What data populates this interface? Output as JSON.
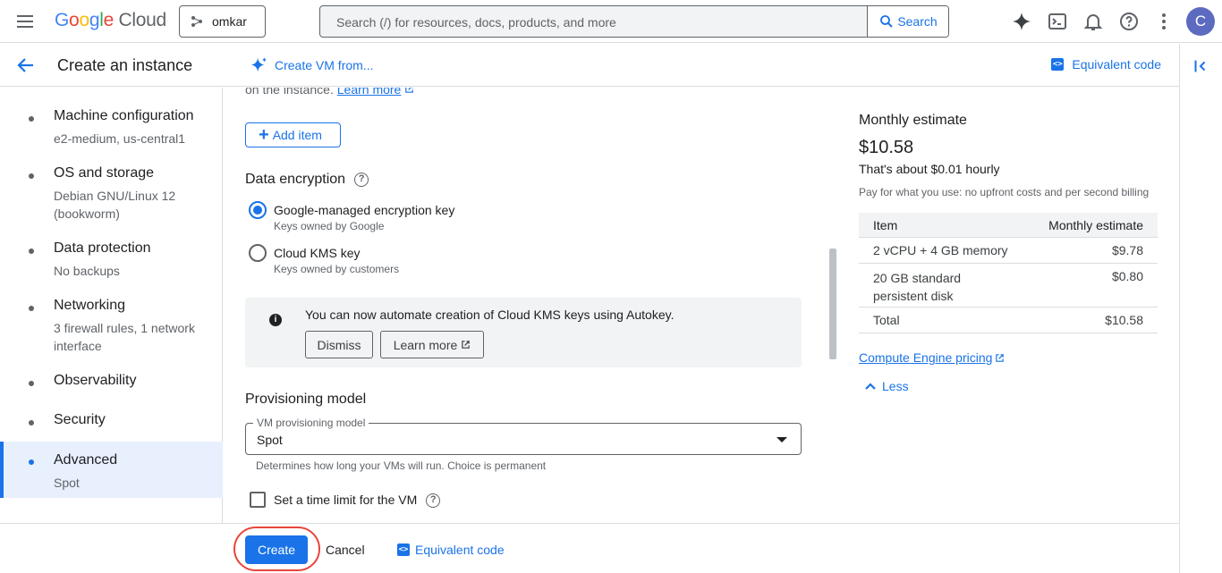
{
  "topbar": {
    "logo_google": "Google",
    "logo_cloud": "Cloud",
    "project": "omkar",
    "search_placeholder": "Search (/) for resources, docs, products, and more",
    "search_button": "Search",
    "avatar_letter": "C"
  },
  "header": {
    "title": "Create an instance",
    "create_from": "Create VM from...",
    "equivalent_code": "Equivalent code"
  },
  "nav": [
    {
      "label": "Machine configuration",
      "sub": "e2-medium, us-central1"
    },
    {
      "label": "OS and storage",
      "sub": "Debian GNU/Linux 12 (bookworm)"
    },
    {
      "label": "Data protection",
      "sub": "No backups"
    },
    {
      "label": "Networking",
      "sub": "3 firewall rules, 1 network interface"
    },
    {
      "label": "Observability",
      "sub": ""
    },
    {
      "label": "Security",
      "sub": ""
    },
    {
      "label": "Advanced",
      "sub": "Spot"
    }
  ],
  "main": {
    "cut_text": "on the instance.",
    "learn_more": "Learn more",
    "add_item": "Add item",
    "data_encryption": {
      "title": "Data encryption",
      "options": [
        {
          "label": "Google-managed encryption key",
          "sub": "Keys owned by Google",
          "checked": true
        },
        {
          "label": "Cloud KMS key",
          "sub": "Keys owned by customers",
          "checked": false
        }
      ]
    },
    "info": {
      "message": "You can now automate creation of Cloud KMS keys using Autokey.",
      "dismiss": "Dismiss",
      "learn_more": "Learn more"
    },
    "provisioning": {
      "title": "Provisioning model",
      "select_label": "VM provisioning model",
      "select_value": "Spot",
      "hint": "Determines how long your VMs will run. Choice is permanent",
      "time_limit_label": "Set a time limit for the VM"
    }
  },
  "estimate": {
    "title": "Monthly estimate",
    "amount": "$10.58",
    "hourly": "That's about $0.01 hourly",
    "note": "Pay for what you use: no upfront costs and per second billing",
    "table_header": {
      "item": "Item",
      "estimate": "Monthly estimate"
    },
    "rows": [
      {
        "item": "2 vCPU + 4 GB memory",
        "value": "$9.78"
      },
      {
        "item": "20 GB standard persistent disk",
        "value": "$0.80"
      },
      {
        "item": "Total",
        "value": "$10.58"
      }
    ],
    "pricing_link": "Compute Engine pricing",
    "less": "Less"
  },
  "footer": {
    "create": "Create",
    "cancel": "Cancel",
    "equivalent_code": "Equivalent code"
  },
  "colors": {
    "accent": "#1a73e8",
    "highlight": "#e8453c"
  }
}
